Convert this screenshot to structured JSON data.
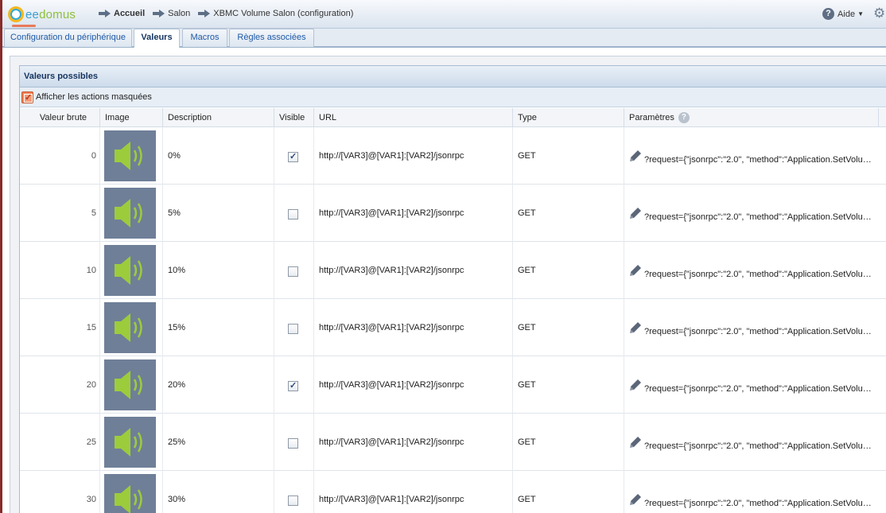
{
  "app": {
    "logo_text_a": "ee",
    "logo_text_b": "domus"
  },
  "breadcrumb": [
    "Accueil",
    "Salon",
    "XBMC Volume Salon (configuration)"
  ],
  "help": {
    "label": "Aide"
  },
  "tabs": [
    {
      "label": "Configuration du périphérique",
      "active": false
    },
    {
      "label": "Valeurs",
      "active": true
    },
    {
      "label": "Macros",
      "active": false
    },
    {
      "label": "Règles associées",
      "active": false
    }
  ],
  "panel": {
    "title": "Valeurs possibles",
    "show_hidden_label": "Afficher les actions masquées",
    "show_hidden_checked": true
  },
  "table": {
    "columns": [
      "Valeur brute",
      "Image",
      "Description",
      "Visible",
      "URL",
      "Type",
      "Paramètres"
    ],
    "image_icon": "speaker-volume-icon",
    "rows": [
      {
        "raw": "0",
        "description": "0%",
        "visible": true,
        "url": "http://[VAR3]@[VAR1]:[VAR2]/jsonrpc",
        "type": "GET",
        "params": "?request={\"jsonrpc\":\"2.0\", \"method\":\"Application.SetVolum..."
      },
      {
        "raw": "5",
        "description": "5%",
        "visible": false,
        "url": "http://[VAR3]@[VAR1]:[VAR2]/jsonrpc",
        "type": "GET",
        "params": "?request={\"jsonrpc\":\"2.0\", \"method\":\"Application.SetVolum..."
      },
      {
        "raw": "10",
        "description": "10%",
        "visible": false,
        "url": "http://[VAR3]@[VAR1]:[VAR2]/jsonrpc",
        "type": "GET",
        "params": "?request={\"jsonrpc\":\"2.0\", \"method\":\"Application.SetVolum..."
      },
      {
        "raw": "15",
        "description": "15%",
        "visible": false,
        "url": "http://[VAR3]@[VAR1]:[VAR2]/jsonrpc",
        "type": "GET",
        "params": "?request={\"jsonrpc\":\"2.0\", \"method\":\"Application.SetVolum..."
      },
      {
        "raw": "20",
        "description": "20%",
        "visible": true,
        "url": "http://[VAR3]@[VAR1]:[VAR2]/jsonrpc",
        "type": "GET",
        "params": "?request={\"jsonrpc\":\"2.0\", \"method\":\"Application.SetVolum..."
      },
      {
        "raw": "25",
        "description": "25%",
        "visible": false,
        "url": "http://[VAR3]@[VAR1]:[VAR2]/jsonrpc",
        "type": "GET",
        "params": "?request={\"jsonrpc\":\"2.0\", \"method\":\"Application.SetVolum..."
      },
      {
        "raw": "30",
        "description": "30%",
        "visible": false,
        "url": "http://[VAR3]@[VAR1]:[VAR2]/jsonrpc",
        "type": "GET",
        "params": "?request={\"jsonrpc\":\"2.0\", \"method\":\"Application.SetVolum..."
      }
    ]
  },
  "colors": {
    "accent": "#1f5aa6",
    "speaker_bg": "#6f7f98",
    "speaker_fg": "#9ccc3c",
    "toggle": "#f28058"
  }
}
